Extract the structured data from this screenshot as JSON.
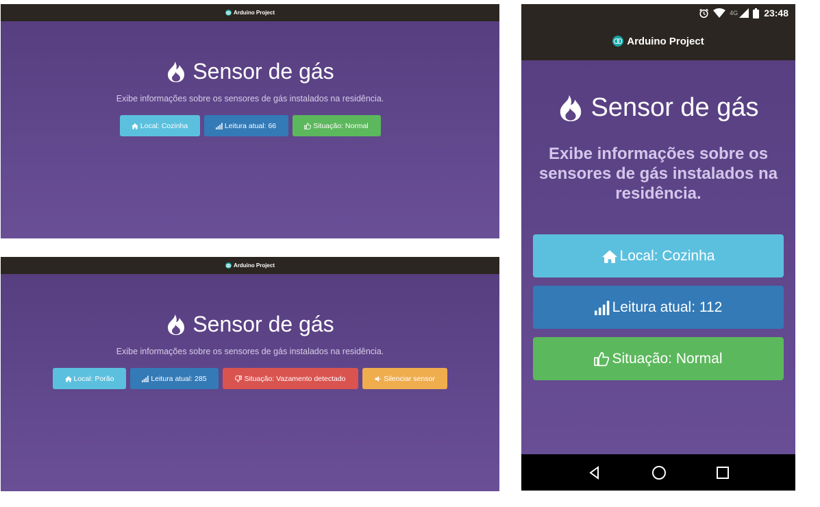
{
  "panels": {
    "desktop_normal": {
      "brand": "Arduino Project",
      "title": "Sensor de gás",
      "subtitle": "Exibe informações sobre os sensores de gás instalados na residência.",
      "buttons": {
        "local": "Local: Cozinha",
        "reading": "Leitura atual: 66",
        "status": "Situação: Normal"
      }
    },
    "desktop_alert": {
      "brand": "Arduino Project",
      "title": "Sensor de gás",
      "subtitle": "Exibe informações sobre os sensores de gás instalados na residência.",
      "buttons": {
        "local": "Local: Porão",
        "reading": "Leitura atual: 285",
        "status": "Situação: Vazamento detectado",
        "silence": "Silenciar sensor"
      }
    },
    "mobile": {
      "status_bar": {
        "time": "23:48",
        "network": "4G"
      },
      "brand": "Arduino Project",
      "title": "Sensor de gás",
      "subtitle": "Exibe informações sobre os sensores de gás instalados na residência.",
      "buttons": {
        "local": "Local: Cozinha",
        "reading": "Leitura atual: 112",
        "status": "Situação: Normal"
      }
    }
  },
  "colors": {
    "background_top": "#553d7e",
    "background_bottom": "#6a4f97",
    "navbar": "#2b2621",
    "info": "#5bc0de",
    "primary": "#337ab7",
    "success": "#5cb85c",
    "danger": "#d9534f",
    "warning": "#f0ad4e"
  },
  "icons": [
    "arduino-logo-icon",
    "flame-icon",
    "home-icon",
    "signal-bars-icon",
    "thumbs-up-icon",
    "thumbs-down-icon",
    "volume-icon",
    "alarm-icon",
    "wifi-icon",
    "cell-signal-icon",
    "battery-icon",
    "back-icon",
    "home-nav-icon",
    "recents-icon"
  ]
}
